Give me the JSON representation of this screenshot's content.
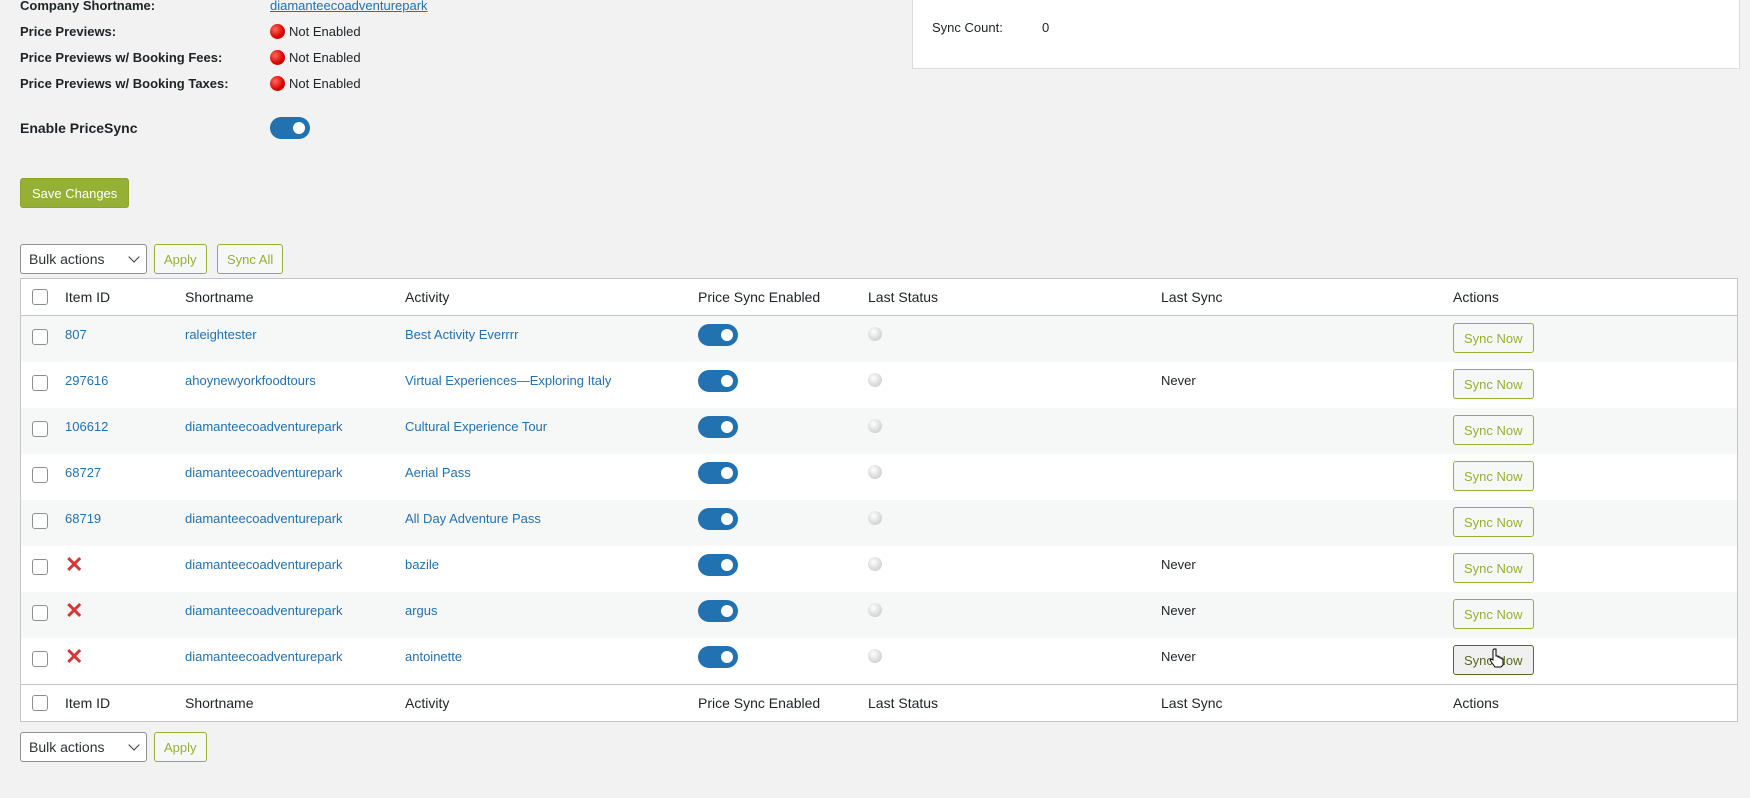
{
  "info": [
    {
      "label": "Company Shortname:",
      "value": "diamanteecoadventurepark",
      "type": "link"
    },
    {
      "label": "Price Previews:",
      "value": "Not Enabled",
      "type": "status"
    },
    {
      "label": "Price Previews w/ Booking Fees:",
      "value": "Not Enabled",
      "type": "status"
    },
    {
      "label": "Price Previews w/ Booking Taxes:",
      "value": "Not Enabled",
      "type": "status"
    }
  ],
  "panel": {
    "sync_count_label": "Sync Count:",
    "sync_count_value": "0"
  },
  "enable_pricesync": {
    "label": "Enable PriceSync",
    "on": true
  },
  "save_button": "Save Changes",
  "bulk": {
    "select_value": "Bulk actions",
    "apply": "Apply",
    "sync_all": "Sync All"
  },
  "columns": [
    "Item ID",
    "Shortname",
    "Activity",
    "Price Sync Enabled",
    "Last Status",
    "Last Sync",
    "Actions"
  ],
  "rows": [
    {
      "item_id": "807",
      "valid": true,
      "shortname": "raleightester",
      "activity": "Best Activity Everrrr",
      "last_sync": "",
      "action": "Sync Now"
    },
    {
      "item_id": "297616",
      "valid": true,
      "shortname": "ahoynewyorkfoodtours",
      "activity": "Virtual Experiences—Exploring Italy",
      "last_sync": "Never",
      "action": "Sync Now"
    },
    {
      "item_id": "106612",
      "valid": true,
      "shortname": "diamanteecoadventurepark",
      "activity": "Cultural Experience Tour",
      "last_sync": "",
      "action": "Sync Now"
    },
    {
      "item_id": "68727",
      "valid": true,
      "shortname": "diamanteecoadventurepark",
      "activity": "Aerial Pass",
      "last_sync": "",
      "action": "Sync Now"
    },
    {
      "item_id": "68719",
      "valid": true,
      "shortname": "diamanteecoadventurepark",
      "activity": "All Day Adventure Pass",
      "last_sync": "",
      "action": "Sync Now"
    },
    {
      "item_id": "",
      "valid": false,
      "shortname": "diamanteecoadventurepark",
      "activity": "bazile",
      "last_sync": "Never",
      "action": "Sync Now"
    },
    {
      "item_id": "",
      "valid": false,
      "shortname": "diamanteecoadventurepark",
      "activity": "argus",
      "last_sync": "Never",
      "action": "Sync Now"
    },
    {
      "item_id": "",
      "valid": false,
      "shortname": "diamanteecoadventurepark",
      "activity": "antoinette",
      "last_sync": "Never",
      "action": "Sync Now"
    }
  ],
  "bulk_bottom": {
    "select_value": "Bulk actions",
    "apply": "Apply"
  }
}
